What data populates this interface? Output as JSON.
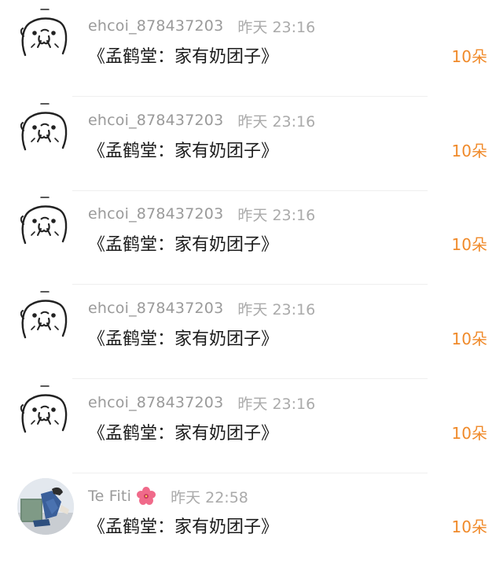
{
  "gift_records": [
    {
      "username": "ehcoi_878437203",
      "date": "昨天",
      "time": "23:16",
      "gift": "《孟鹤堂：家有奶团子》",
      "count": "10朵",
      "avatar": "seal-sticker-icon"
    },
    {
      "username": "ehcoi_878437203",
      "date": "昨天",
      "time": "23:16",
      "gift": "《孟鹤堂：家有奶团子》",
      "count": "10朵",
      "avatar": "seal-sticker-icon"
    },
    {
      "username": "ehcoi_878437203",
      "date": "昨天",
      "time": "23:16",
      "gift": "《孟鹤堂：家有奶团子》",
      "count": "10朵",
      "avatar": "seal-sticker-icon"
    },
    {
      "username": "ehcoi_878437203",
      "date": "昨天",
      "time": "23:16",
      "gift": "《孟鹤堂：家有奶团子》",
      "count": "10朵",
      "avatar": "seal-sticker-icon"
    },
    {
      "username": "ehcoi_878437203",
      "date": "昨天",
      "time": "23:16",
      "gift": "《孟鹤堂：家有奶团子》",
      "count": "10朵",
      "avatar": "seal-sticker-icon"
    },
    {
      "username": "Te Fiti",
      "date": "昨天",
      "time": "22:58",
      "gift": "《孟鹤堂：家有奶团子》",
      "count": "10朵",
      "avatar": "photo-avatar",
      "badge": "hibiscus-flower-icon"
    }
  ],
  "colors": {
    "username": "#9a9a9a",
    "time": "#aaaaaa",
    "gift_title": "#1c1c1c",
    "count_accent": "#f08a2a",
    "divider": "#efefef",
    "flower": "#f06a8a"
  }
}
